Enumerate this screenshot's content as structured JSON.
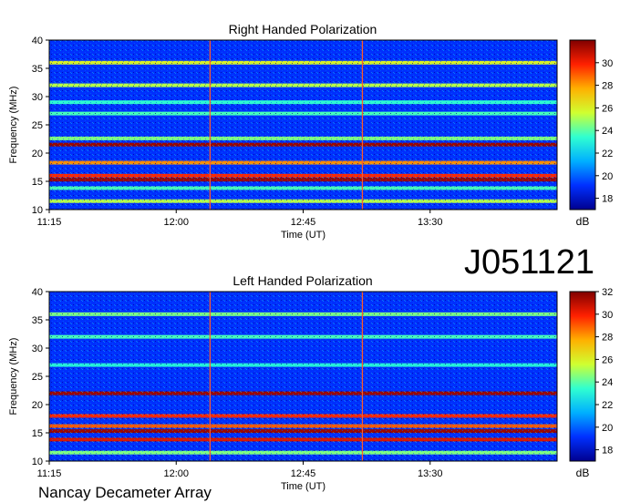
{
  "figure_label": "J051121",
  "footer": "Nancay Decameter Array",
  "chart_data": [
    {
      "type": "heatmap",
      "title": "Right Handed Polarization",
      "xlabel": "Time (UT)",
      "ylabel": "Frequency (MHz)",
      "x_ticks": [
        "11:15",
        "12:00",
        "12:45",
        "13:30"
      ],
      "y_ticks": [
        10,
        15,
        20,
        25,
        30,
        35,
        40
      ],
      "xlim": [
        "11:15",
        "14:15"
      ],
      "ylim": [
        10,
        40
      ],
      "colorbar": {
        "label": "dB",
        "range": [
          17,
          32
        ],
        "ticks": [
          18,
          20,
          22,
          24,
          26,
          28,
          30
        ]
      },
      "colormap": [
        "#00008f",
        "#0030ff",
        "#00b0ff",
        "#30ffd0",
        "#d0ff30",
        "#ffb000",
        "#ff2000",
        "#800000"
      ],
      "interference_bands_mhz": [
        {
          "f": 11.5,
          "level": 0.55
        },
        {
          "f": 13.8,
          "level": 0.45
        },
        {
          "f": 15.3,
          "level": 0.97
        },
        {
          "f": 16.0,
          "level": 0.85
        },
        {
          "f": 18.3,
          "level": 0.75
        },
        {
          "f": 21.5,
          "level": 0.97
        },
        {
          "f": 22.6,
          "level": 0.5
        },
        {
          "f": 27.0,
          "level": 0.45
        },
        {
          "f": 29.0,
          "level": 0.42
        },
        {
          "f": 32.0,
          "level": 0.55
        },
        {
          "f": 36.0,
          "level": 0.6
        }
      ],
      "impulsive_events_ut": [
        "12:12",
        "13:06"
      ]
    },
    {
      "type": "heatmap",
      "title": "Left Handed Polarization",
      "xlabel": "Time (UT)",
      "ylabel": "Frequency (MHz)",
      "x_ticks": [
        "11:15",
        "12:00",
        "12:45",
        "13:30"
      ],
      "y_ticks": [
        10,
        15,
        20,
        25,
        30,
        35,
        40
      ],
      "xlim": [
        "11:15",
        "14:15"
      ],
      "ylim": [
        10,
        40
      ],
      "colorbar": {
        "label": "dB",
        "range": [
          17,
          32
        ],
        "ticks": [
          18,
          20,
          22,
          24,
          26,
          28,
          30,
          32
        ]
      },
      "colormap": [
        "#00008f",
        "#0030ff",
        "#00b0ff",
        "#30ffd0",
        "#d0ff30",
        "#ffb000",
        "#ff2000",
        "#800000"
      ],
      "interference_bands_mhz": [
        {
          "f": 11.5,
          "level": 0.5
        },
        {
          "f": 13.8,
          "level": 0.9
        },
        {
          "f": 15.3,
          "level": 0.97
        },
        {
          "f": 16.2,
          "level": 0.8
        },
        {
          "f": 18.0,
          "level": 0.85
        },
        {
          "f": 22.0,
          "level": 0.97
        },
        {
          "f": 27.0,
          "level": 0.4
        },
        {
          "f": 32.0,
          "level": 0.45
        },
        {
          "f": 36.0,
          "level": 0.5
        }
      ],
      "impulsive_events_ut": [
        "12:12",
        "13:06"
      ]
    }
  ]
}
